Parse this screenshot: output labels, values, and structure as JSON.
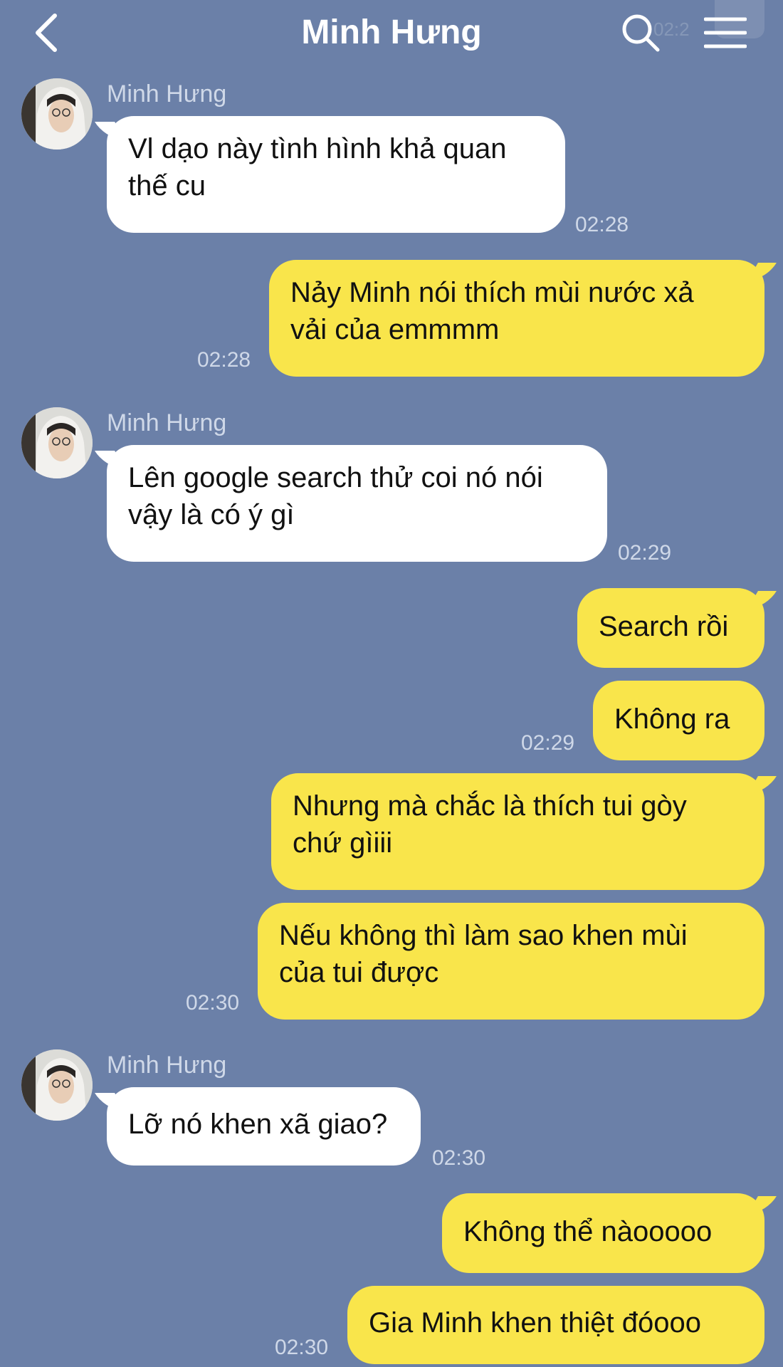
{
  "header": {
    "title": "Minh Hưng",
    "back_icon": "chevron-left-icon",
    "search_icon": "search-icon",
    "menu_icon": "hamburger-menu-icon",
    "ghost_time": "02:2"
  },
  "colors": {
    "background": "#6b80a8",
    "incoming_bubble": "#ffffff",
    "outgoing_bubble": "#f9e54b"
  },
  "messages": [
    {
      "direction": "in",
      "sender": "Minh Hưng",
      "text": "Vl dạo này tình hình khả quan\nthế cu",
      "time": "02:28"
    },
    {
      "direction": "out",
      "text": "Nảy Minh nói thích mùi nước xả\nvải của emmmm",
      "time": "02:28"
    },
    {
      "direction": "in",
      "sender": "Minh Hưng",
      "text": "Lên google search thử coi nó nói\nvậy là có ý gì",
      "time": "02:29"
    },
    {
      "direction": "out",
      "text": "Search rồi",
      "time": ""
    },
    {
      "direction": "out",
      "text": "Không ra",
      "time": "02:29"
    },
    {
      "direction": "out",
      "text": "Nhưng mà chắc là thích tui gòy\nchứ gìiii",
      "time": ""
    },
    {
      "direction": "out",
      "text": "Nếu không thì làm sao khen mùi\ncủa tui được",
      "time": "02:30"
    },
    {
      "direction": "in",
      "sender": "Minh Hưng",
      "text": "Lỡ nó khen xã giao?",
      "time": "02:30"
    },
    {
      "direction": "out",
      "text": "Không thể nàooooo",
      "time": ""
    },
    {
      "direction": "out",
      "text": "Gia Minh khen thiệt đóooo",
      "time": "02:30"
    }
  ]
}
